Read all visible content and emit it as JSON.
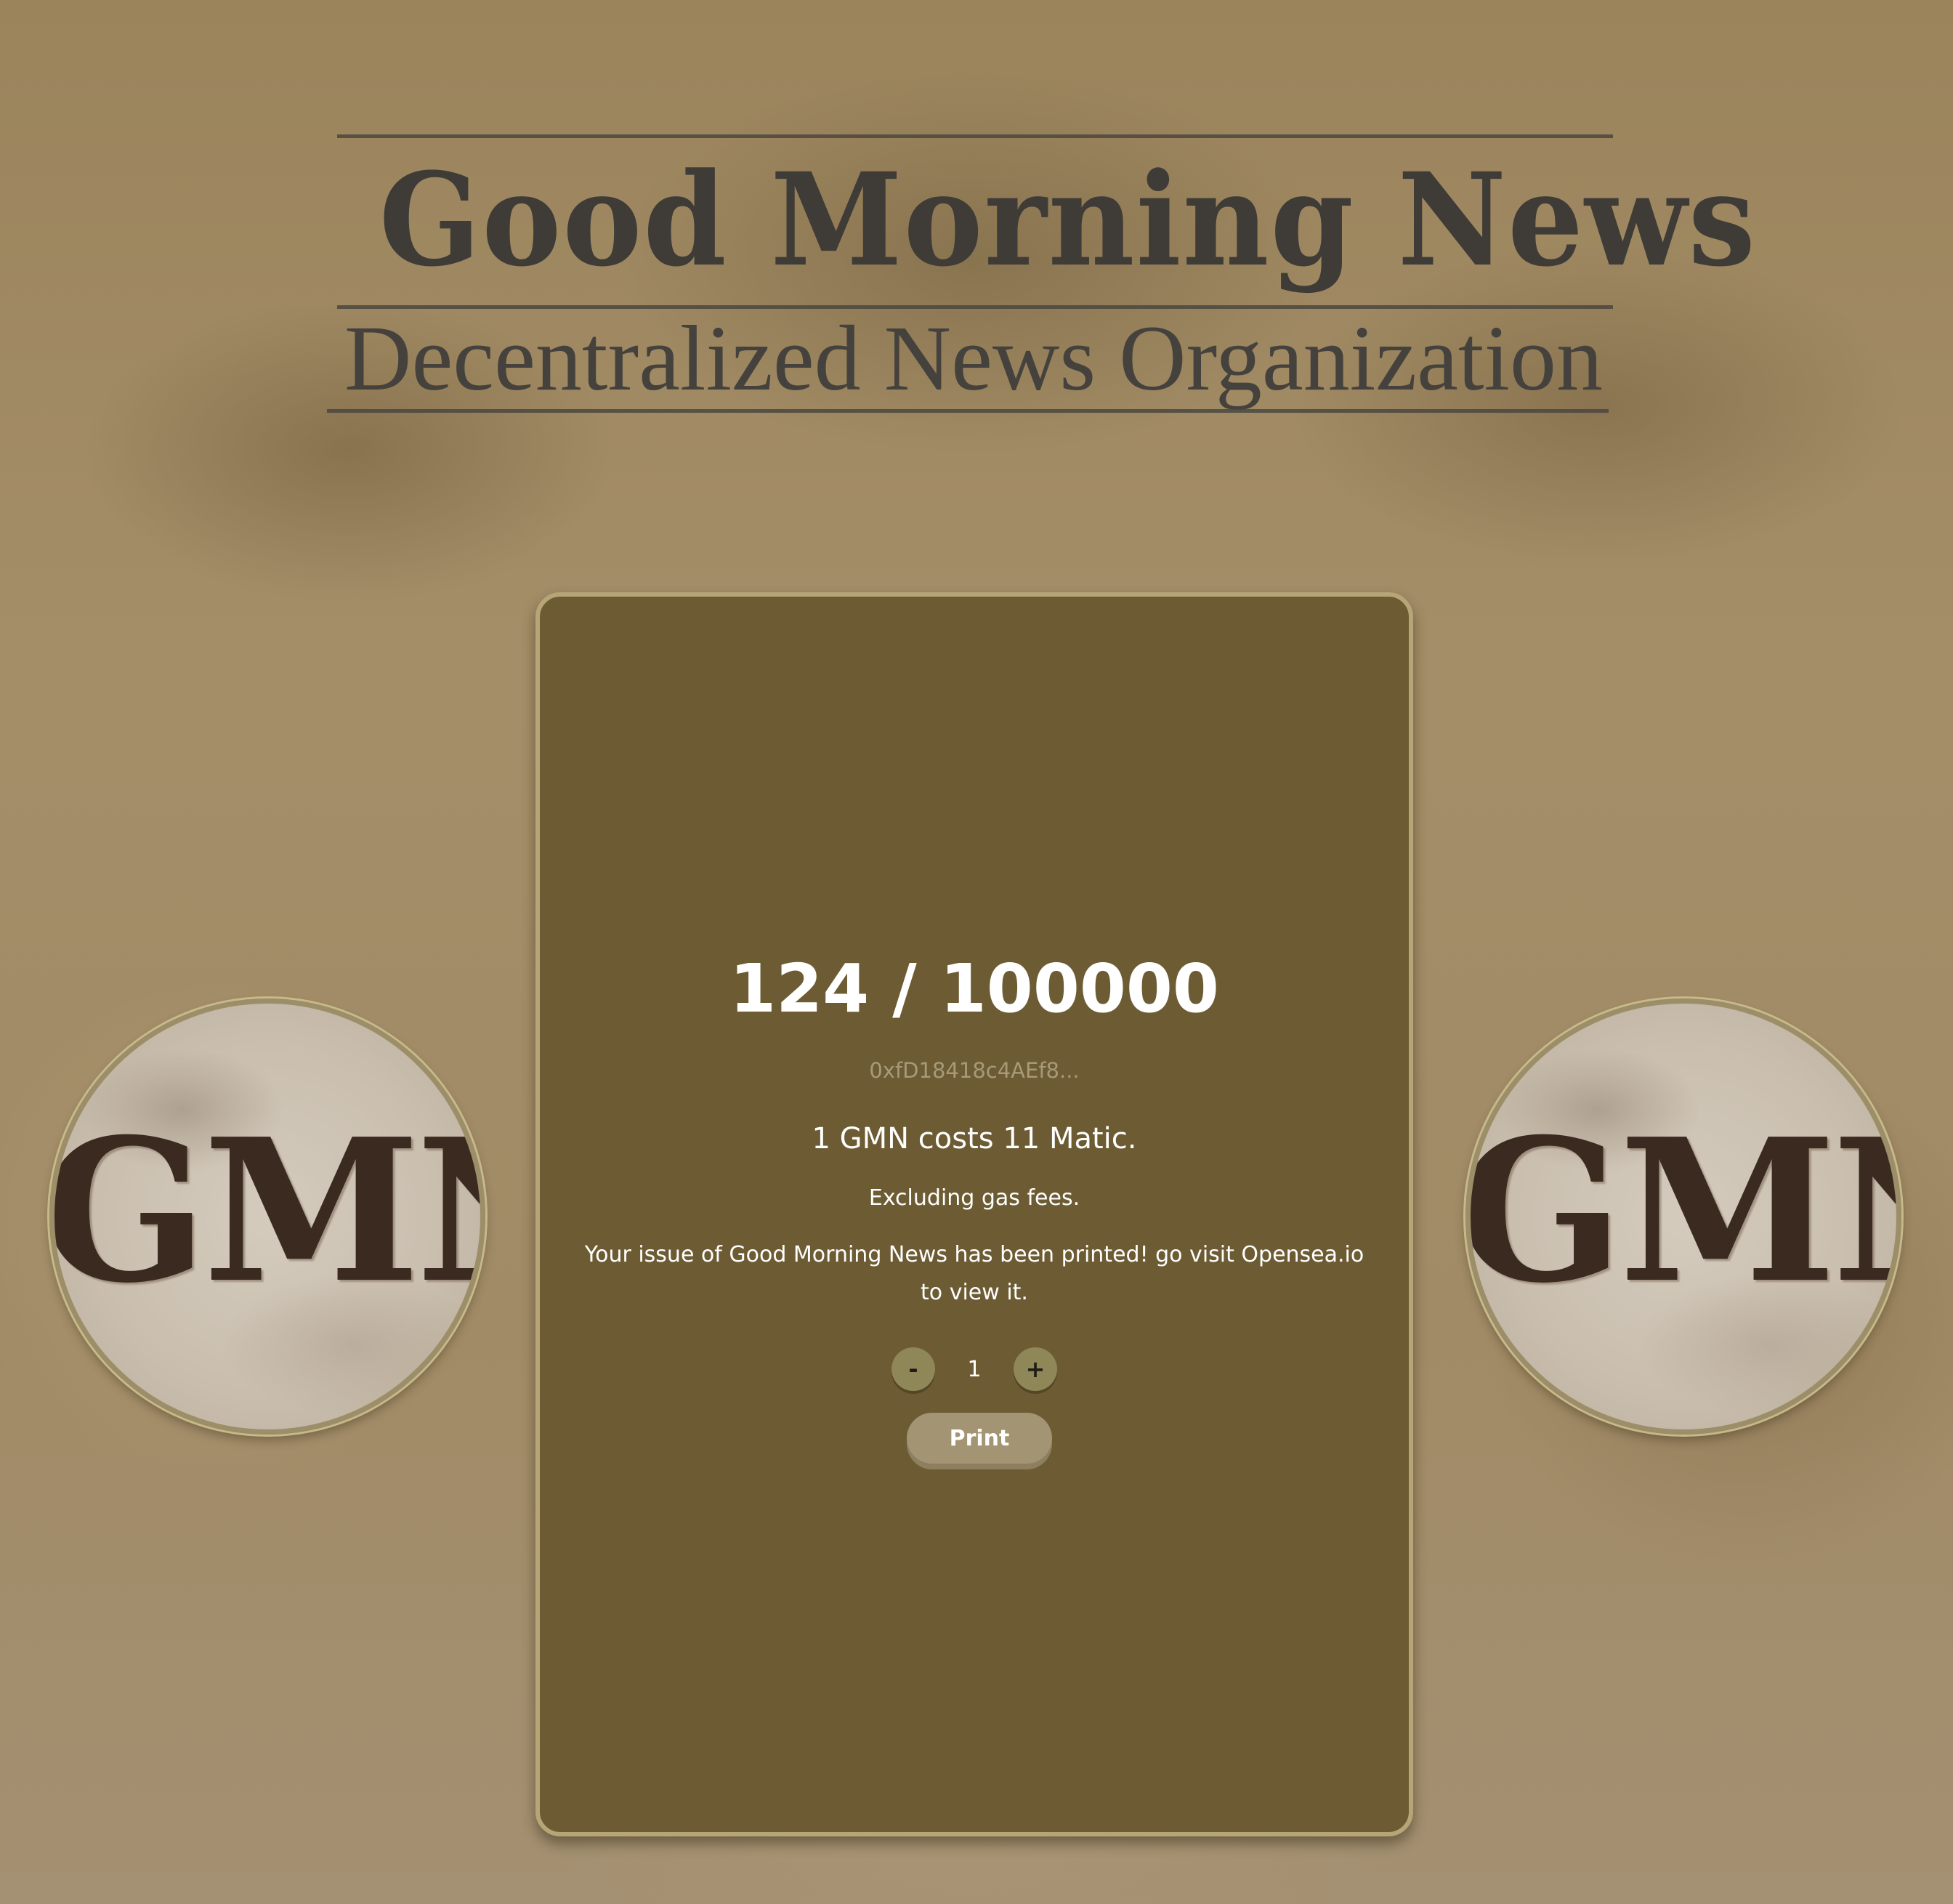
{
  "masthead": {
    "title": "Good Morning News",
    "subtitle": "Decentralized News Organization"
  },
  "mint": {
    "counter": "124 / 100000",
    "contract_address": "0xfD18418c4AEf8...",
    "cost_text": "1 GMN costs 11 Matic.",
    "gas_note": "Excluding gas fees.",
    "status_message": "Your issue of Good Morning News has been printed! go visit Opensea.io to view it.",
    "decrement_label": "-",
    "quantity": "1",
    "increment_label": "+",
    "print_label": "Print"
  },
  "logos": {
    "left_text": "GMN",
    "right_text": "GMN"
  }
}
